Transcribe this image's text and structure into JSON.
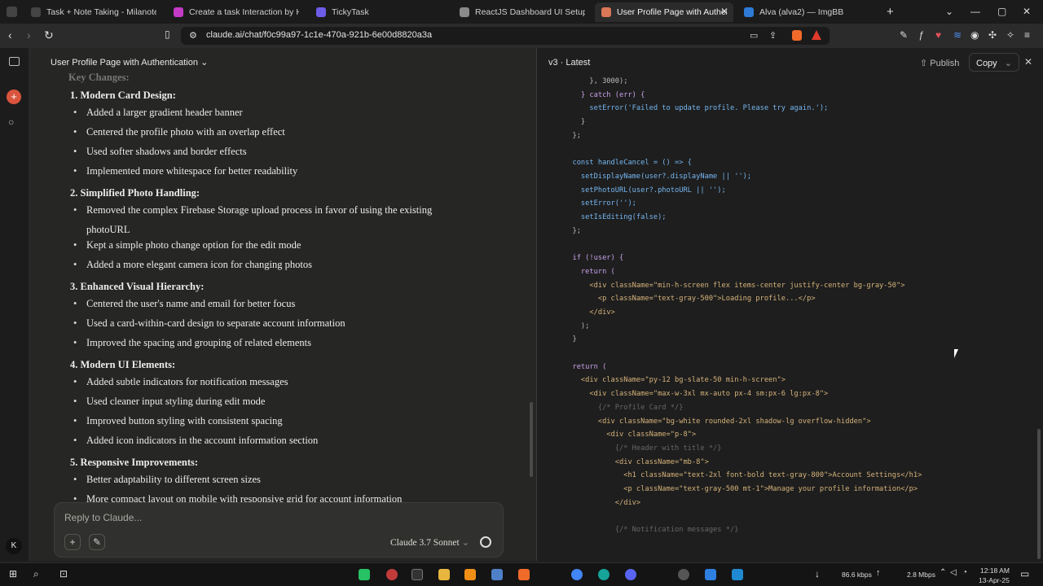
{
  "browser": {
    "tabs": [
      {
        "title": "Task + Note Taking - Milanote",
        "active": false,
        "color": "#444444"
      },
      {
        "title": "Create a task Interaction by Happy ...",
        "active": false,
        "color": "#c43ac6"
      },
      {
        "title": "TickyTask",
        "active": false,
        "color": "#6c5ce7"
      },
      {
        "title": "ReactJS Dashboard UI Setup",
        "active": false,
        "color": "#8a8a8a"
      },
      {
        "title": "User Profile Page with Authentic",
        "active": true,
        "color": "#d97757"
      },
      {
        "title": "Alva (alva2) — ImgBB",
        "active": false,
        "color": "#2d7bd6"
      }
    ],
    "url": "claude.ai/chat/f0c99a97-1c1e-470a-921b-6e00d8820a3a"
  },
  "chat": {
    "title": "User Profile Page with Authentication",
    "partial_heading": "Key Changes:",
    "items": [
      {
        "title": "1. Modern Card Design:",
        "bullets": [
          "Added a larger gradient header banner",
          "Centered the profile photo with an overlap effect",
          "Used softer shadows and border effects",
          "Implemented more whitespace for better readability"
        ]
      },
      {
        "title": "2. Simplified Photo Handling:",
        "bullets": [
          "Removed the complex Firebase Storage upload process in favor of using the existing",
          "photoURL",
          "Kept a simple photo change option for the edit mode",
          "Added a more elegant camera icon for changing photos"
        ]
      },
      {
        "title": "3. Enhanced Visual Hierarchy:",
        "bullets": [
          "Centered the user's name and email for better focus",
          "Used a card-within-card design to separate account information",
          "Improved the spacing and grouping of related elements"
        ]
      },
      {
        "title": "4. Modern UI Elements:",
        "bullets": [
          "Added subtle indicators for notification messages",
          "Used cleaner input styling during edit mode",
          "Improved button styling with consistent spacing",
          "Added icon indicators in the account information section"
        ]
      },
      {
        "title": "5. Responsive Improvements:",
        "bullets": [
          "Better adaptability to different screen sizes",
          "More compact layout on mobile with responsive grid for account information"
        ]
      }
    ],
    "composer_placeholder": "Reply to Claude...",
    "model": "Claude 3.7 Sonnet"
  },
  "artifact": {
    "version": "v3 · Latest",
    "publish": "Publish",
    "copy": "Copy",
    "code_lines": [
      {
        "t": "      }, 3000);",
        "c": "p"
      },
      {
        "t": "    } catch (err) {",
        "c": "k"
      },
      {
        "t": "      setError('Failed to update profile. Please try again.');",
        "c": "f"
      },
      {
        "t": "    }",
        "c": "p"
      },
      {
        "t": "  };",
        "c": "p"
      },
      {
        "t": "",
        "c": "p"
      },
      {
        "t": "  const handleCancel = () => {",
        "c": "f"
      },
      {
        "t": "    setDisplayName(user?.displayName || '');",
        "c": "f"
      },
      {
        "t": "    setPhotoURL(user?.photoURL || '');",
        "c": "f"
      },
      {
        "t": "    setError('');",
        "c": "f"
      },
      {
        "t": "    setIsEditing(false);",
        "c": "f"
      },
      {
        "t": "  };",
        "c": "p"
      },
      {
        "t": "",
        "c": "p"
      },
      {
        "t": "  if (!user) {",
        "c": "k"
      },
      {
        "t": "    return (",
        "c": "k"
      },
      {
        "t": "      <div className=\"min-h-screen flex items-center justify-center bg-gray-50\">",
        "c": "s"
      },
      {
        "t": "        <p className=\"text-gray-500\">Loading profile...</p>",
        "c": "s"
      },
      {
        "t": "      </div>",
        "c": "s"
      },
      {
        "t": "    );",
        "c": "p"
      },
      {
        "t": "  }",
        "c": "p"
      },
      {
        "t": "",
        "c": "p"
      },
      {
        "t": "  return (",
        "c": "k"
      },
      {
        "t": "    <div className=\"py-12 bg-slate-50 min-h-screen\">",
        "c": "s"
      },
      {
        "t": "      <div className=\"max-w-3xl mx-auto px-4 sm:px-6 lg:px-8\">",
        "c": "s"
      },
      {
        "t": "        {/* Profile Card */}",
        "c": "c"
      },
      {
        "t": "        <div className=\"bg-white rounded-2xl shadow-lg overflow-hidden\">",
        "c": "s"
      },
      {
        "t": "          <div className=\"p-8\">",
        "c": "s"
      },
      {
        "t": "            {/* Header with title */}",
        "c": "c"
      },
      {
        "t": "            <div className=\"mb-8\">",
        "c": "s"
      },
      {
        "t": "              <h1 className=\"text-2xl font-bold text-gray-800\">Account Settings</h1>",
        "c": "s"
      },
      {
        "t": "              <p className=\"text-gray-500 mt-1\">Manage your profile information</p>",
        "c": "s"
      },
      {
        "t": "            </div>",
        "c": "s"
      },
      {
        "t": "",
        "c": "p"
      },
      {
        "t": "            {/* Notification messages */}",
        "c": "c"
      }
    ]
  },
  "taskbar": {
    "network_speed": "86.6 kbps",
    "upload_speed": "2.8 Mbps",
    "time": "12:18 AM",
    "date": "13-Apr-25"
  },
  "profile_avatar": "K"
}
